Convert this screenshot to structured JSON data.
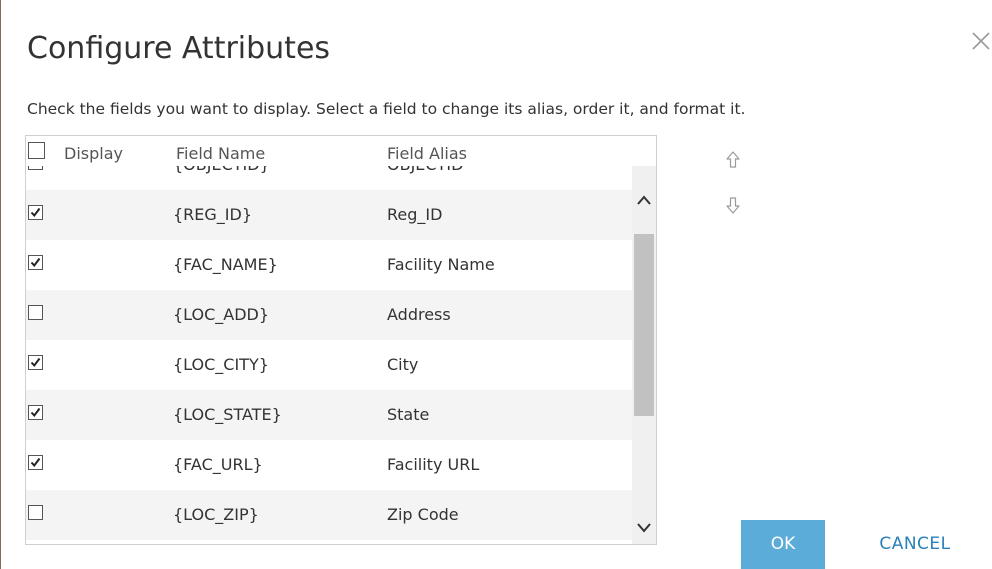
{
  "dialog": {
    "title": "Configure Attributes",
    "instructions": "Check the fields you want to display. Select a field to change its alias, order it, and format it."
  },
  "table": {
    "columns": {
      "display": "Display",
      "field_name": "Field Name",
      "field_alias": "Field Alias"
    },
    "select_all_checked": false,
    "rows": [
      {
        "checked": false,
        "field_name": "{OBJECTID}",
        "field_alias": "OBJECTID"
      },
      {
        "checked": true,
        "field_name": "{REG_ID}",
        "field_alias": "Reg_ID"
      },
      {
        "checked": true,
        "field_name": "{FAC_NAME}",
        "field_alias": "Facility Name"
      },
      {
        "checked": false,
        "field_name": "{LOC_ADD}",
        "field_alias": "Address"
      },
      {
        "checked": true,
        "field_name": "{LOC_CITY}",
        "field_alias": "City"
      },
      {
        "checked": true,
        "field_name": "{LOC_STATE}",
        "field_alias": "State"
      },
      {
        "checked": true,
        "field_name": "{FAC_URL}",
        "field_alias": "Facility URL"
      },
      {
        "checked": false,
        "field_name": "{LOC_ZIP}",
        "field_alias": "Zip Code"
      }
    ]
  },
  "icons": {
    "close": "close-icon",
    "move_up": "arrow-up-icon",
    "move_down": "arrow-down-icon",
    "scroll_up": "chevron-up-icon",
    "scroll_down": "chevron-down-icon",
    "check": "checkmark-icon"
  },
  "buttons": {
    "ok": "OK",
    "cancel": "CANCEL"
  },
  "colors": {
    "ok_background": "#5cacd9",
    "cancel_text": "#2a80b9",
    "row_alt": "#f4f4f4"
  }
}
